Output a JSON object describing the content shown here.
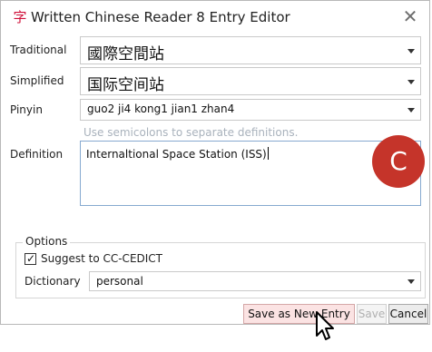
{
  "window": {
    "title": "Written Chinese Reader 8 Entry Editor",
    "app_icon_char": "字",
    "close_glyph": "✕"
  },
  "fields": {
    "traditional": {
      "label": "Traditional",
      "value": "國際空間站"
    },
    "simplified": {
      "label": "Simplified",
      "value": "国际空间站"
    },
    "pinyin": {
      "label": "Pinyin",
      "value": "guo2 ji4 kong1 jian1 zhan4"
    },
    "definition": {
      "label": "Definition",
      "hint": "Use semicolons to separate definitions.",
      "value": "Internaltional Space Station (ISS)"
    }
  },
  "badge": {
    "letter": "C",
    "color": "#c5342a"
  },
  "options": {
    "legend": "Options",
    "suggest_label": "Suggest to CC-CEDICT",
    "suggest_checked": true,
    "dictionary_label": "Dictionary",
    "dictionary_value": "personal"
  },
  "buttons": {
    "save_new": "Save as New Entry",
    "save": "Save",
    "cancel": "Cancel"
  },
  "icons": {
    "app": "app-character-icon",
    "close": "close-icon",
    "dropdown": "chevron-down-icon",
    "cursor": "mouse-pointer-icon"
  },
  "colors": {
    "app_icon": "#d0103a",
    "hint_text": "#a9b2bc",
    "save_new_button_bg": "#fbe3e3"
  }
}
